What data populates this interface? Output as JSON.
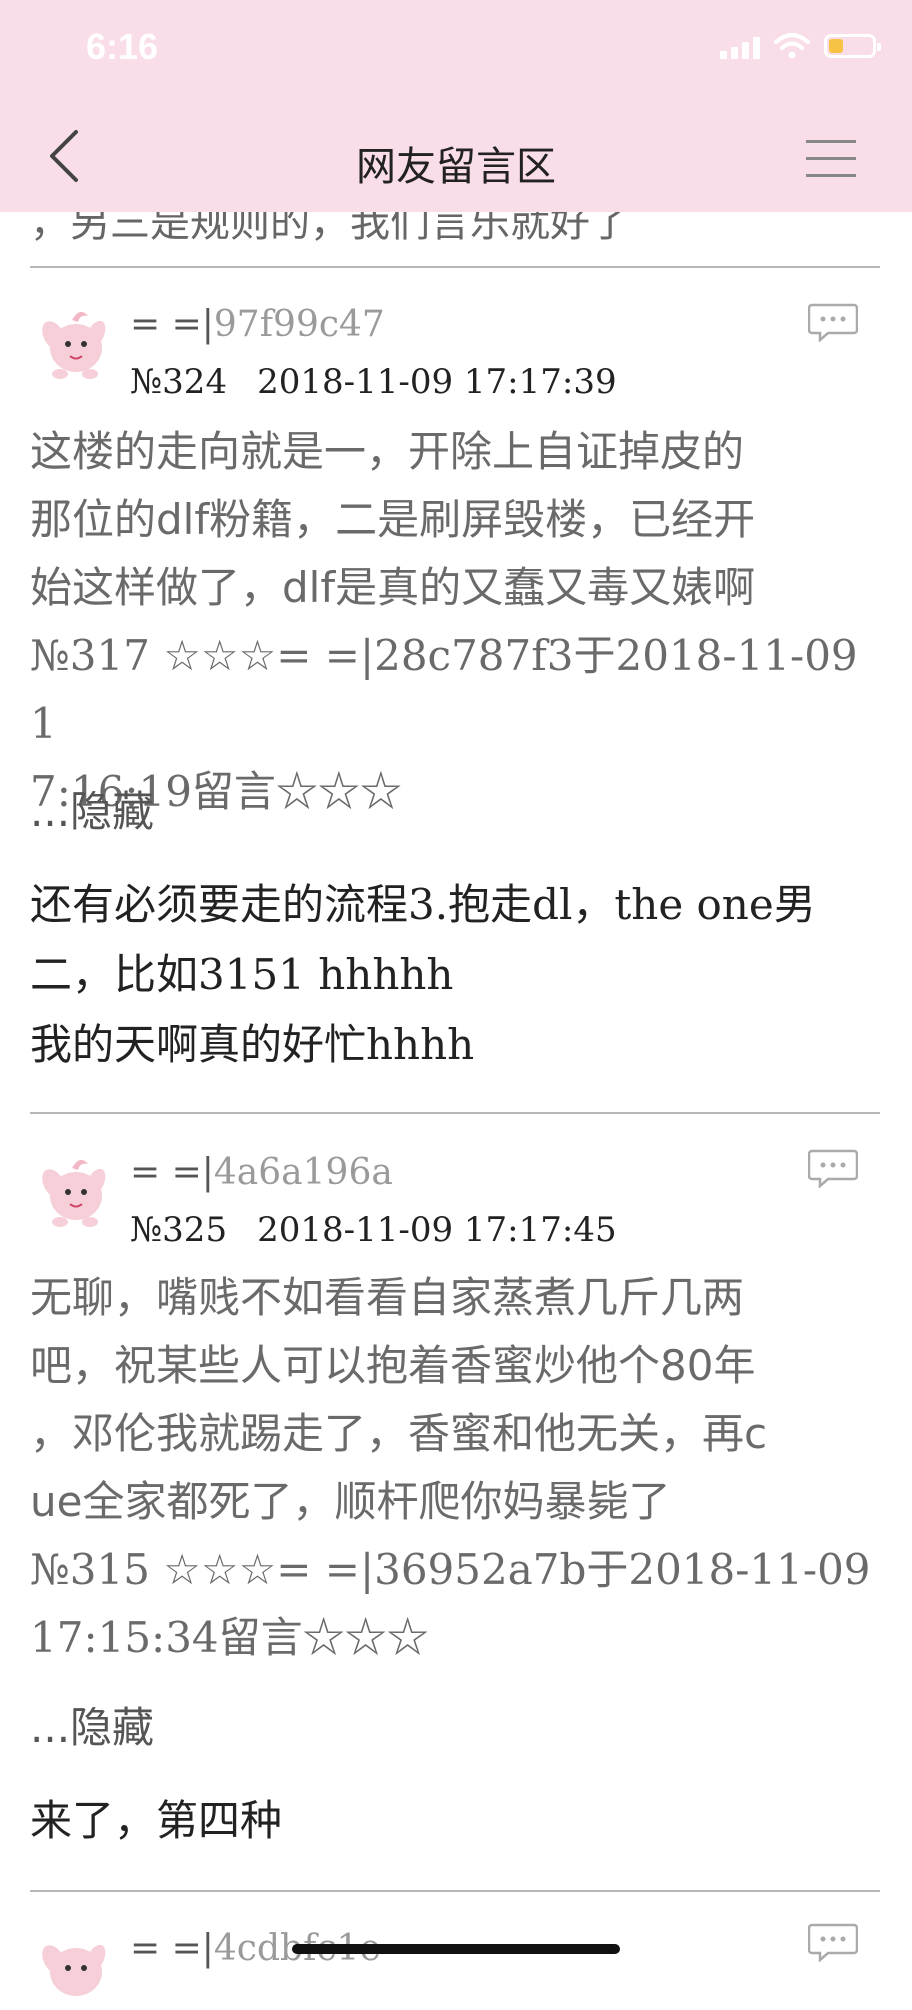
{
  "status_bar": {
    "time": "6:16"
  },
  "header": {
    "title": "网友留言区"
  },
  "partial_top_text": "，另三是规则的，我们言乐就好了",
  "posts": [
    {
      "user_prefix": "= =|",
      "user_id": "97f99c47",
      "number": "№324",
      "datetime": "2018-11-09 17:17:39",
      "quote_lines": [
        "这楼的走向就是一，开除上自证掉皮的",
        "那位的dlf粉籍，二是刷屏毁楼，已经开",
        "始这样做了，dlf是真的又蠢又毒又婊啊",
        "№317 ☆☆☆= =|28c787f3于2018-11-09 1",
        "7:16:19留言☆☆☆"
      ],
      "hide_label": "...隐藏",
      "reply_lines": [
        "还有必须要走的流程3.抱走dl，the one男",
        "二，比如3151 hhhhh",
        "我的天啊真的好忙hhhh"
      ]
    },
    {
      "user_prefix": "= =|",
      "user_id": "4a6a196a",
      "number": "№325",
      "datetime": "2018-11-09 17:17:45",
      "quote_lines": [
        "无聊，嘴贱不如看看自家蒸煮几斤几两",
        "吧，祝某些人可以抱着香蜜炒他个80年",
        "，邓伦我就踢走了，香蜜和他无关，再c",
        "ue全家都死了，顺杆爬你妈暴毙了",
        "№315 ☆☆☆= =|36952a7b于2018-11-09",
        "17:15:34留言☆☆☆"
      ],
      "hide_label": "...隐藏",
      "reply_lines": [
        "来了，第四种"
      ]
    },
    {
      "user_prefix": "= =|",
      "user_id": "4cdbfc1e"
    }
  ],
  "colors": {
    "header_bg": "#f9dde9",
    "quote_text": "#6a6a6a",
    "battery": "#f6c344"
  },
  "icons": [
    "back-icon",
    "menu-icon",
    "comment-icon",
    "avatar-icon"
  ]
}
